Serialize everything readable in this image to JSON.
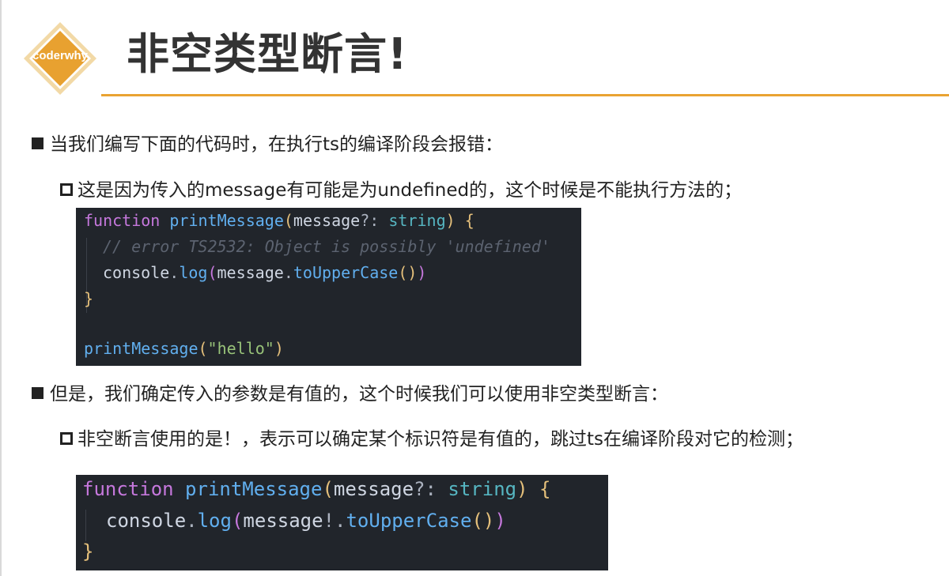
{
  "header": {
    "logo_text": "coderwhy",
    "title": "非空类型断言!",
    "accent_color": "#e9a332"
  },
  "bullets": [
    {
      "level": 1,
      "text": "当我们编写下面的代码时，在执行ts的编译阶段会报错："
    },
    {
      "level": 2,
      "text": "这是因为传入的message有可能是为undefined的，这个时候是不能执行方法的；"
    },
    {
      "level": 1,
      "text": "但是，我们确定传入的参数是有值的，这个时候我们可以使用非空类型断言："
    },
    {
      "level": 2,
      "text": "非空断言使用的是！，表示可以确定某个标识符是有值的，跳过ts在编译阶段对它的检测；"
    }
  ],
  "code1": {
    "background": "#21252b",
    "kw": "function",
    "fn": "printMessage",
    "paren_open": "(",
    "param": "message",
    "optional": "?:",
    "type": "string",
    "paren_close": ")",
    "brace_open": "{",
    "comment": "// error TS2532: Object is possibly 'undefined'",
    "console": "console",
    "dot": ".",
    "log": "log",
    "log_open": "(",
    "arg": "message",
    "arg_dot": ".",
    "method": "toUpperCase",
    "method_parens": "()",
    "log_close": ")",
    "brace_close": "}",
    "call_fn": "printMessage",
    "call_open": "(",
    "call_arg": "\"hello\"",
    "call_close": ")"
  },
  "code2": {
    "background": "#21252b",
    "kw": "function",
    "fn": "printMessage",
    "paren_open": "(",
    "param": "message",
    "optional": "?:",
    "type": "string",
    "paren_close": ")",
    "brace_open": "{",
    "console": "console",
    "dot": ".",
    "log": "log",
    "log_open": "(",
    "arg": "message",
    "bang": "!",
    "arg_dot": ".",
    "method": "toUpperCase",
    "method_parens": "()",
    "log_close": ")",
    "brace_close": "}"
  }
}
